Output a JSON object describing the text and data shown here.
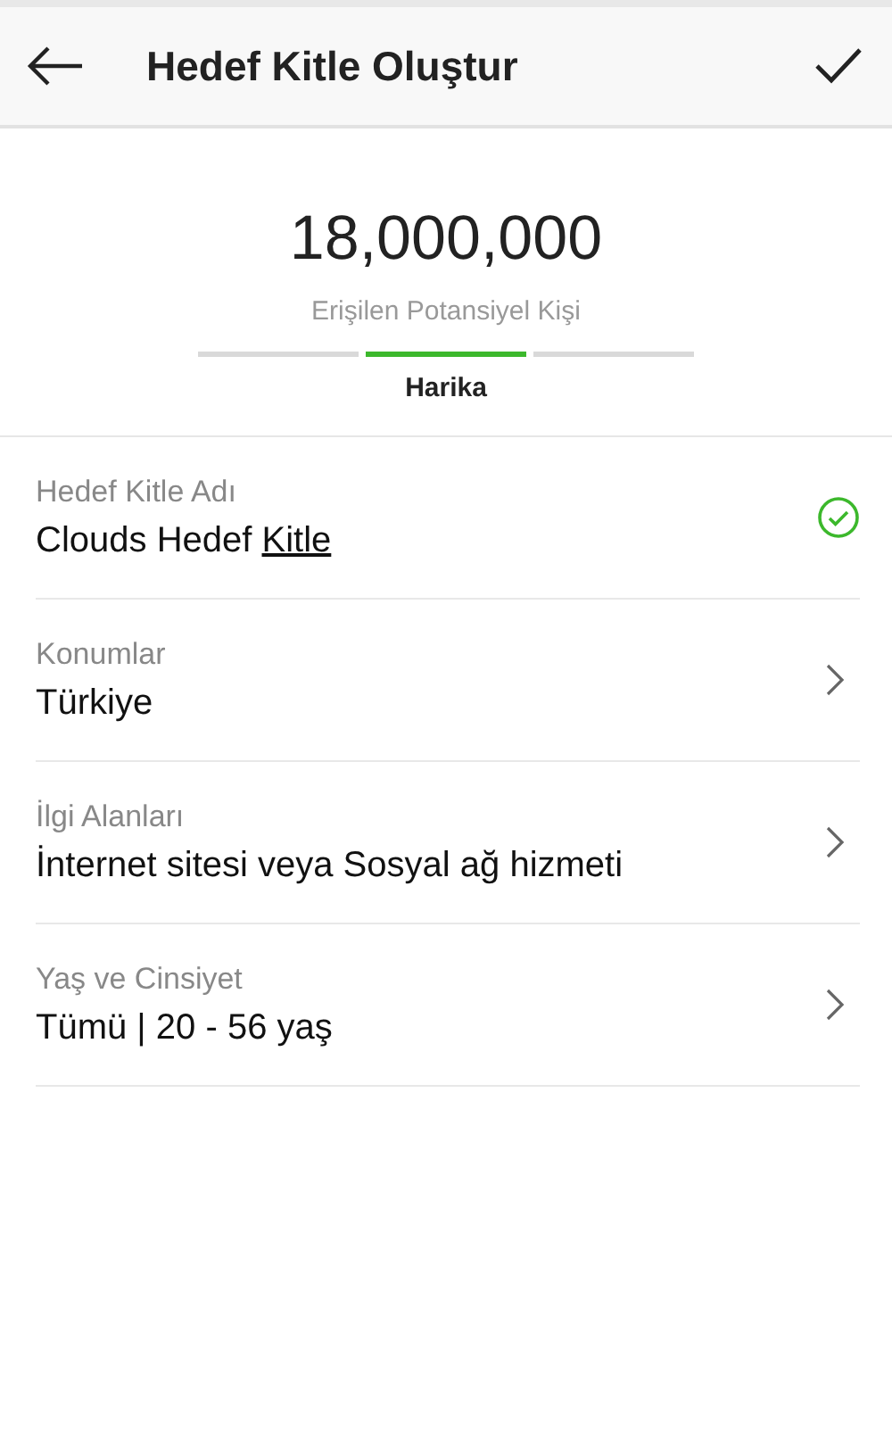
{
  "header": {
    "title": "Hedef Kitle Oluştur"
  },
  "reach": {
    "count": "18,000,000",
    "label": "Erişilen Potansiyel Kişi",
    "segments": [
      {
        "selected": false
      },
      {
        "selected": true
      },
      {
        "selected": false
      }
    ],
    "rating": "Harika"
  },
  "fields": [
    {
      "label": "Hedef Kitle Adı",
      "kind": "valid",
      "value_parts": [
        {
          "text": "Clouds Hedef ",
          "underlined": false
        },
        {
          "text": "Kitle",
          "underlined": true
        }
      ]
    },
    {
      "label": "Konumlar",
      "kind": "link",
      "value_parts": [
        {
          "text": "Türkiye",
          "underlined": false
        }
      ]
    },
    {
      "label": "İlgi Alanları",
      "kind": "link",
      "value_parts": [
        {
          "text": "İnternet sitesi veya Sosyal ağ hizmeti",
          "underlined": false
        }
      ]
    },
    {
      "label": "Yaş ve Cinsiyet",
      "kind": "link",
      "value_parts": [
        {
          "text": "Tümü | 20 - 56 yaş",
          "underlined": false
        }
      ]
    }
  ]
}
